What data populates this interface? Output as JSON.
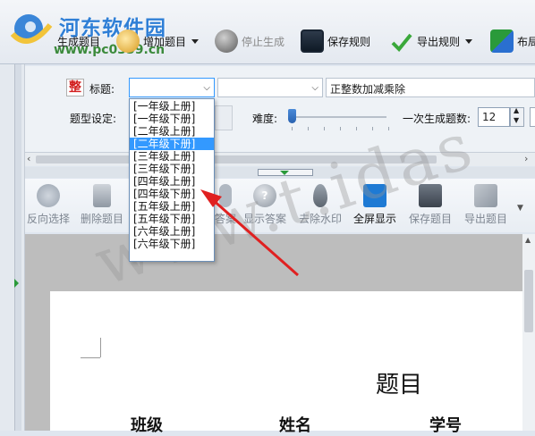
{
  "watermark_site": "河东软件园",
  "watermark_url": "www.pc0359.cn",
  "toolbar": {
    "generate": "生成题目",
    "add": "增加题目",
    "stop": "停止生成",
    "save_rules": "保存规则",
    "export_rules": "导出规则",
    "layout": "布局"
  },
  "form": {
    "zheng_badge": "整",
    "title_label": "标题:",
    "title_value": "正整数加减乘除",
    "type_label": "题型设定:",
    "difficulty_label": "难度:",
    "count_label": "一次生成题数:",
    "count_value": "12",
    "difficulty_level": 0.0
  },
  "grade_options": [
    "[一年级上册]",
    "[一年级下册]",
    "[二年级上册]",
    "[二年级下册]",
    "[三年级上册]",
    "[三年级下册]",
    "[四年级上册]",
    "[四年级下册]",
    "[五年级上册]",
    "[五年级下册]",
    "[六年级上册]",
    "[六年级下册]"
  ],
  "grade_selected_index": 3,
  "toolbar2": {
    "reverse": "反向选择",
    "delete": "删除题目",
    "answer_partial": "答案",
    "show_answer": "显示答案",
    "remove_watermark": "去除水印",
    "fullscreen": "全屏显示",
    "save_questions": "保存题目",
    "export_questions": "导出题目"
  },
  "document": {
    "heading": "题目",
    "class_label": "班级",
    "name_label": "姓名",
    "id_label": "学号",
    "watermark_text": "www.t.idas"
  },
  "colors": {
    "accent": "#3399ff",
    "arrow": "#e02020",
    "site_blue": "#2f7fd6",
    "site_green": "#3b8a3b"
  }
}
